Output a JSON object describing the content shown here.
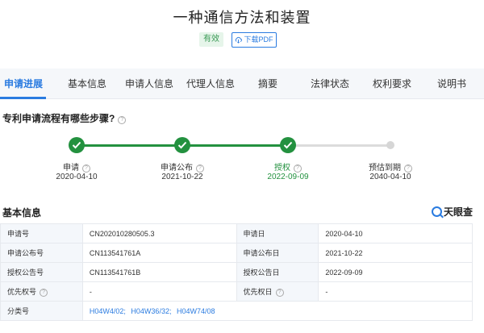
{
  "header": {
    "title": "一种通信方法和装置",
    "status": "有效",
    "pdf_label": "下载PDF"
  },
  "tabs": [
    {
      "label": "申请进展"
    },
    {
      "label": "基本信息"
    },
    {
      "label": "申请人信息"
    },
    {
      "label": "代理人信息"
    },
    {
      "label": "摘要"
    },
    {
      "label": "法律状态"
    },
    {
      "label": "权利要求"
    },
    {
      "label": "说明书"
    }
  ],
  "active_tab": "申请进展",
  "process": {
    "title": "专利申请流程有哪些步骤?",
    "steps": [
      {
        "label": "申请",
        "date": "2020-04-10",
        "state": "done"
      },
      {
        "label": "申请公布",
        "date": "2021-10-22",
        "state": "done"
      },
      {
        "label": "授权",
        "date": "2022-09-09",
        "state": "current"
      },
      {
        "label": "预估到期",
        "date": "2040-04-10",
        "state": "pending"
      }
    ]
  },
  "basic_info": {
    "title": "基本信息",
    "logo_text": "天眼查",
    "rows": [
      {
        "k1": "申请号",
        "v1": "CN202010280505.3",
        "k2": "申请日",
        "v2": "2020-04-10"
      },
      {
        "k1": "申请公布号",
        "v1": "CN113541761A",
        "k2": "申请公布日",
        "v2": "2021-10-22"
      },
      {
        "k1": "授权公告号",
        "v1": "CN113541761B",
        "k2": "授权公告日",
        "v2": "2022-09-09"
      },
      {
        "k1": "优先权号",
        "v1": "-",
        "k2": "优先权日",
        "v2": "-"
      }
    ],
    "classification_label": "分类号",
    "classifications": [
      "H04W4/02;",
      "H04W36/32;",
      "H04W74/08"
    ]
  },
  "colors": {
    "accent": "#2a7be0",
    "success": "#23913f",
    "badge_bg": "#e6f5ea"
  }
}
